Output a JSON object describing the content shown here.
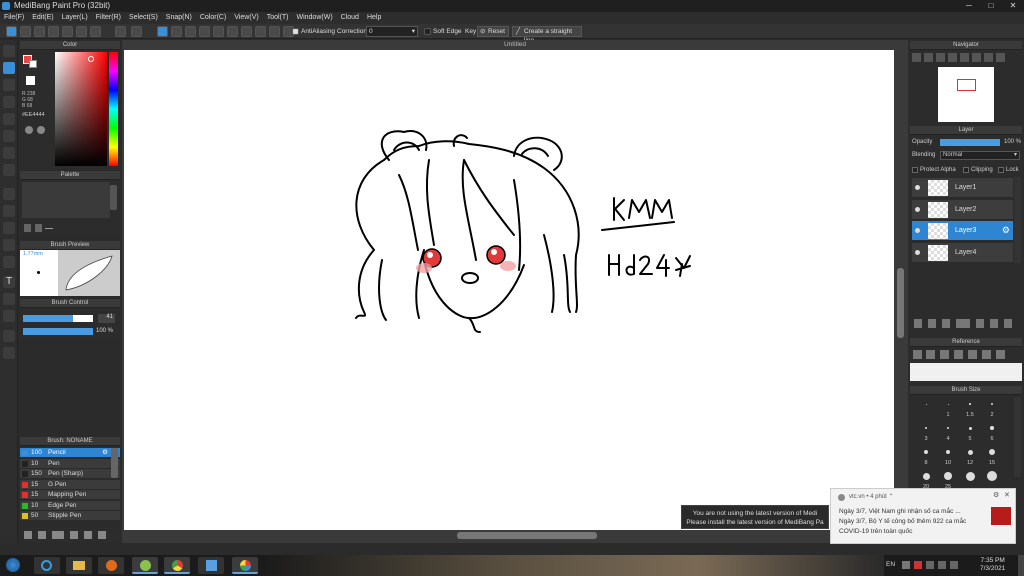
{
  "window": {
    "title": "MediBang Paint Pro (32bit)"
  },
  "menu": [
    "File(F)",
    "Edit(E)",
    "Layer(L)",
    "Filter(R)",
    "Select(S)",
    "Snap(N)",
    "Color(C)",
    "View(V)",
    "Tool(T)",
    "Window(W)",
    "Cloud",
    "Help"
  ],
  "toolbar": {
    "antialiasing": "AntiAliasing",
    "correction_label": "Correction",
    "correction_value": "0",
    "soft_edge": "Soft Edge",
    "key": "Key",
    "reset": "Reset",
    "straight_line": "Create a straight line"
  },
  "document": {
    "title": "Untitled"
  },
  "color_panel": {
    "title": "Color",
    "r": "R 238",
    "g": "G 68",
    "b": "B 68",
    "hex": "#EE4444"
  },
  "palette_panel": {
    "title": "Palette"
  },
  "brush_preview": {
    "title": "Brush Preview",
    "size": "1.77mm"
  },
  "brush_control": {
    "title": "Brush Control",
    "size_value": "41",
    "opacity_value": "100 %"
  },
  "brush_list": {
    "title": "Brush: NONAME",
    "items": [
      {
        "size": "100",
        "name": "Pencil",
        "color": "#3a8fd8",
        "selected": true
      },
      {
        "size": "10",
        "name": "Pen",
        "color": "#222"
      },
      {
        "size": "150",
        "name": "Pen (Sharp)",
        "color": "#222"
      },
      {
        "size": "15",
        "name": "G Pen",
        "color": "#e03030"
      },
      {
        "size": "15",
        "name": "Mapping Pen",
        "color": "#e03030"
      },
      {
        "size": "10",
        "name": "Edge Pen",
        "color": "#2db52d"
      },
      {
        "size": "50",
        "name": "Stipple Pen",
        "color": "#e0c020"
      }
    ]
  },
  "navigator": {
    "title": "Navigator"
  },
  "layer_panel": {
    "title": "Layer",
    "opacity_label": "Opacity",
    "opacity_value": "100 %",
    "blending_label": "Blending",
    "blending_value": "Normal",
    "protect_alpha": "Protect Alpha",
    "clipping": "Clipping",
    "lock": "Lock",
    "layers": [
      {
        "name": "Layer1"
      },
      {
        "name": "Layer2"
      },
      {
        "name": "Layer3",
        "selected": true
      },
      {
        "name": "Layer4"
      }
    ]
  },
  "reference_panel": {
    "title": "Reference"
  },
  "brush_size_panel": {
    "title": "Brush Size",
    "labels": [
      "1",
      "1.5",
      "2",
      "3",
      "4",
      "5",
      "6",
      "8",
      "10",
      "12",
      "15",
      "20",
      "25"
    ]
  },
  "update_popup": {
    "line1": "You are not using the latest version of Medi",
    "line2": "Please install the latest version of MediBang Pa"
  },
  "notification": {
    "source": "vtc.vn",
    "time": "4 phút",
    "line1": "Ngày 3/7, Việt Nam ghi nhận số ca mắc ...",
    "line2": "Ngày 3/7, Bộ Y tế công bố thêm 922 ca mắc",
    "line3": "COVID-19 trên toàn quốc"
  },
  "drawing": {
    "text1": "kMM",
    "text2": "Hd24Y"
  },
  "taskbar": {
    "lang": "EN",
    "time": "7:35 PM",
    "date": "7/3/2021"
  }
}
